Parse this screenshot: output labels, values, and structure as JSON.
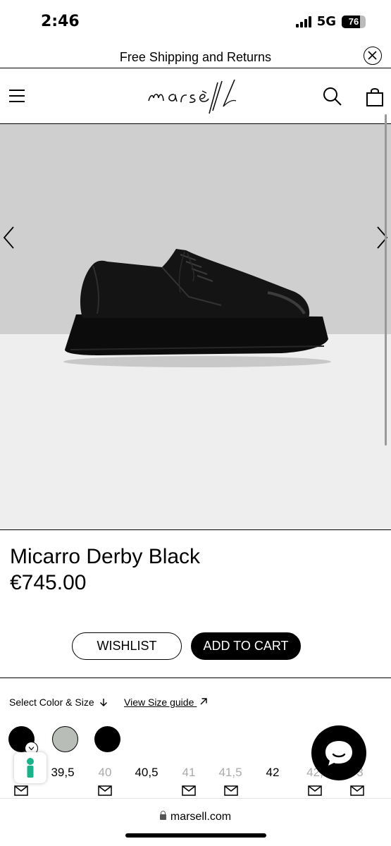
{
  "status_bar": {
    "time": "2:46",
    "network": "5G",
    "battery": "76",
    "battery_level": 0.76,
    "icons": [
      "signal-bars-icon",
      "battery-icon"
    ]
  },
  "promo_banner": {
    "text": "Free Shipping and Returns",
    "close_icon": "close-circle-icon"
  },
  "header": {
    "brand": "marsèll",
    "icons": [
      "hamburger-menu-icon",
      "search-icon",
      "shopping-bag-icon"
    ]
  },
  "gallery": {
    "image": "black-derby-shoe",
    "prev_icon": "chevron-left-icon",
    "next_icon": "chevron-right-icon"
  },
  "product": {
    "name": "Micarro Derby Black",
    "price": "€745.00"
  },
  "actions": {
    "wishlist_label": "WISHLIST",
    "add_to_cart_label": "ADD TO CART"
  },
  "selector": {
    "select_label": "Select Color & Size",
    "size_guide_label": "View Size guide",
    "colors": [
      {
        "name": "black",
        "hex": "#000000",
        "selected": true
      },
      {
        "name": "grey",
        "hex": "#b9bdb8",
        "selected": false
      },
      {
        "name": "black",
        "hex": "#000000",
        "selected": false
      }
    ],
    "sizes": [
      {
        "label": "39,5",
        "available": true
      },
      {
        "label": "40",
        "available": false
      },
      {
        "label": "40,5",
        "available": true
      },
      {
        "label": "41",
        "available": false
      },
      {
        "label": "41,5",
        "available": false
      },
      {
        "label": "42",
        "available": true
      },
      {
        "label": "42,",
        "available": false
      },
      {
        "label": "3",
        "available": false
      }
    ]
  },
  "browser": {
    "url": "marsell.com"
  },
  "colors": {
    "accent": "#000000",
    "wall": "#cfcfcf",
    "floor": "#eeeeee",
    "accessibility": "#1ab28a"
  }
}
